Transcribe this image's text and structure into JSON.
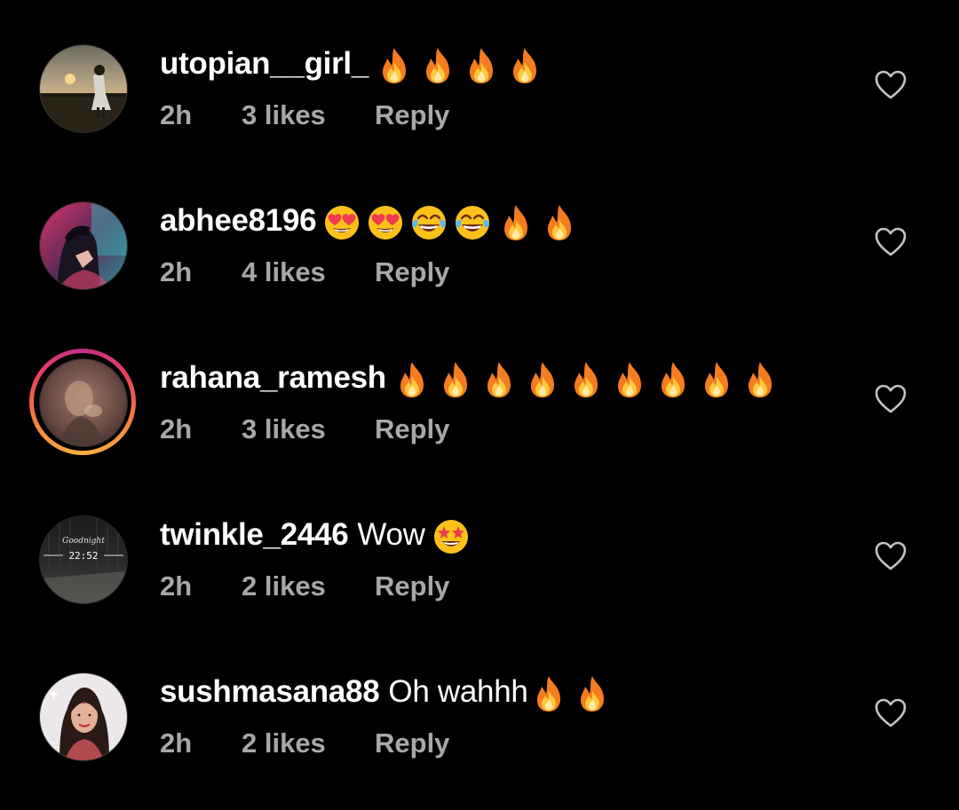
{
  "comments": [
    {
      "username": "utopian__girl_",
      "text": "",
      "emojis": [
        "fire",
        "fire",
        "fire",
        "fire"
      ],
      "time": "2h",
      "likes": "3 likes",
      "reply_label": "Reply"
    },
    {
      "username": "abhee8196",
      "text": "",
      "emojis": [
        "heart-eyes",
        "heart-eyes",
        "joy",
        "joy",
        "fire",
        "fire"
      ],
      "time": "2h",
      "likes": "4 likes",
      "reply_label": "Reply"
    },
    {
      "username": "rahana_ramesh",
      "text": "",
      "emojis": [
        "fire",
        "fire",
        "fire",
        "fire",
        "fire",
        "fire",
        "fire",
        "fire",
        "fire"
      ],
      "time": "2h",
      "likes": "3 likes",
      "reply_label": "Reply",
      "has_story": true
    },
    {
      "username": "twinkle_2446",
      "text": "Wow",
      "emojis": [
        "star-struck"
      ],
      "time": "2h",
      "likes": "2 likes",
      "reply_label": "Reply"
    },
    {
      "username": "sushmasana88",
      "text": "Oh wahhh",
      "emojis": [
        "fire",
        "fire"
      ],
      "time": "2h",
      "likes": "2 likes",
      "reply_label": "Reply"
    }
  ],
  "avatar_texts": {
    "twinkle_line1": "Goodnight",
    "twinkle_line2": "22:52"
  },
  "icons": {
    "like": "heart-outline-icon",
    "avatar": "avatar"
  },
  "colors": {
    "background": "#000000",
    "primary_text": "#ffffff",
    "secondary_text": "#a8a8a8",
    "story_ring": "#e8415f"
  }
}
